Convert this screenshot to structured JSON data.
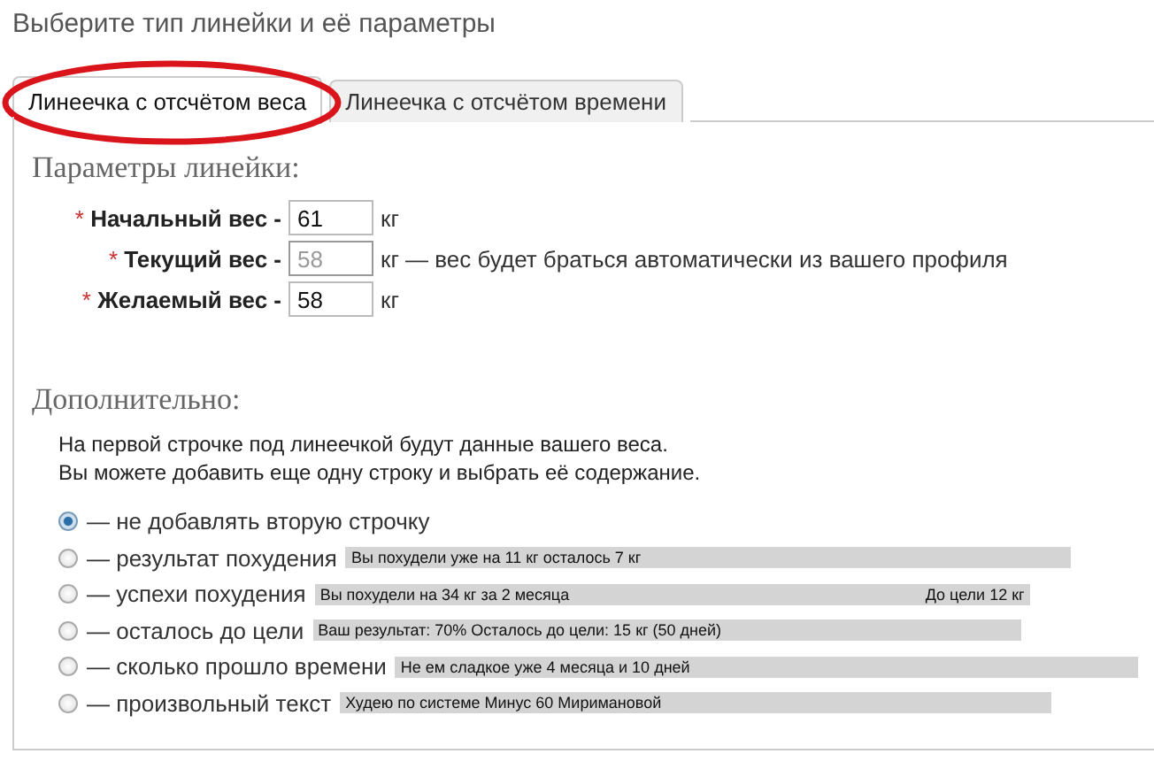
{
  "title": "Выберите тип линейки и её параметры",
  "tabs": [
    {
      "label": "Линеечка с отсчётом веса",
      "selected": true
    },
    {
      "label": "Линеечка с отсчётом времени",
      "selected": false
    }
  ],
  "params": {
    "heading": "Параметры линейки:",
    "fields": [
      {
        "required": "*",
        "label": "Начальный вес -",
        "value": "61",
        "disabled": false,
        "unit": "кг"
      },
      {
        "required": "*",
        "label": "Текущий вес -",
        "value": "58",
        "disabled": true,
        "unit": "кг — вес будет браться автоматически из вашего профиля"
      },
      {
        "required": "*",
        "label": "Желаемый вес -",
        "value": "58",
        "disabled": false,
        "unit": "кг"
      }
    ]
  },
  "extra": {
    "heading": "Дополнительно:",
    "description": [
      "На первой строчке под линеечкой будут данные вашего веса.",
      "Вы можете добавить еще одну строку и выбрать её содержание."
    ],
    "options": [
      {
        "label": "— не добавлять вторую строчку",
        "selected": true
      },
      {
        "label": "— результат похудения",
        "selected": false,
        "preview": "Вы похудели уже на 11 кг  осталось 7 кг"
      },
      {
        "label": "— успехи похудения",
        "selected": false,
        "preview": "Вы похудели на 34 кг за 2 месяца",
        "preview_right": "До цели 12 кг"
      },
      {
        "label": "— осталось до цели",
        "selected": false,
        "preview": "Ваш результат: 70%   Осталось до цели: 15 кг (50 дней)"
      },
      {
        "label": "— сколько прошло времени",
        "selected": false,
        "preview": "Не ем сладкое уже 4 месяца и 10 дней"
      },
      {
        "label": "— произвольный текст",
        "selected": false,
        "preview": "Худею по системе Минус 60 Миримановой"
      }
    ]
  }
}
